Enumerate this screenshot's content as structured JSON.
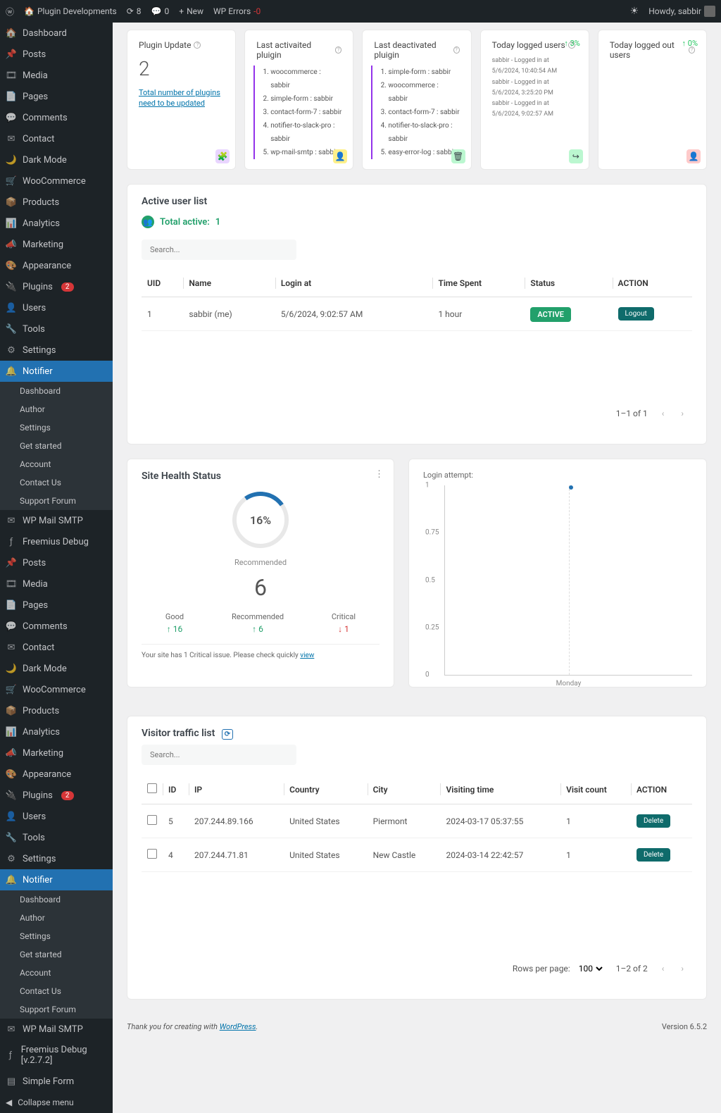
{
  "adminBar": {
    "siteName": "Plugin Developments",
    "updates": "8",
    "comments": "0",
    "newLabel": "New",
    "wpErrors": "WP Errors",
    "wpErrorsCount": "0",
    "howdy": "Howdy, sabbir"
  },
  "sidebar": {
    "items1": [
      {
        "icon": "🏠",
        "label": "Dashboard"
      },
      {
        "icon": "📌",
        "label": "Posts"
      },
      {
        "icon": "🎞",
        "label": "Media"
      },
      {
        "icon": "📄",
        "label": "Pages"
      },
      {
        "icon": "💬",
        "label": "Comments"
      },
      {
        "icon": "✉",
        "label": "Contact"
      },
      {
        "icon": "🌙",
        "label": "Dark Mode"
      },
      {
        "icon": "🛒",
        "label": "WooCommerce"
      },
      {
        "icon": "📦",
        "label": "Products"
      },
      {
        "icon": "📊",
        "label": "Analytics"
      },
      {
        "icon": "📣",
        "label": "Marketing"
      },
      {
        "icon": "🎨",
        "label": "Appearance"
      },
      {
        "icon": "🔌",
        "label": "Plugins",
        "badge": "2"
      },
      {
        "icon": "👤",
        "label": "Users"
      },
      {
        "icon": "🔧",
        "label": "Tools"
      },
      {
        "icon": "⚙",
        "label": "Settings"
      }
    ],
    "notifier": "Notifier",
    "submenu": [
      "Dashboard",
      "Author",
      "Settings",
      "Get started",
      "Account",
      "Contact Us",
      "Support Forum"
    ],
    "wpMailSmtp": "WP Mail SMTP",
    "freemius": "Freemius Debug",
    "items2": [
      {
        "icon": "📌",
        "label": "Posts"
      },
      {
        "icon": "🎞",
        "label": "Media"
      },
      {
        "icon": "📄",
        "label": "Pages"
      },
      {
        "icon": "💬",
        "label": "Comments"
      },
      {
        "icon": "✉",
        "label": "Contact"
      },
      {
        "icon": "🌙",
        "label": "Dark Mode"
      },
      {
        "icon": "🛒",
        "label": "WooCommerce"
      },
      {
        "icon": "📦",
        "label": "Products"
      },
      {
        "icon": "📊",
        "label": "Analytics"
      },
      {
        "icon": "📣",
        "label": "Marketing"
      },
      {
        "icon": "🎨",
        "label": "Appearance"
      },
      {
        "icon": "🔌",
        "label": "Plugins",
        "badge": "2"
      },
      {
        "icon": "👤",
        "label": "Users"
      },
      {
        "icon": "🔧",
        "label": "Tools"
      },
      {
        "icon": "⚙",
        "label": "Settings"
      }
    ],
    "freemius2": "Freemius Debug [v.2.7.2]",
    "simpleForm": "Simple Form",
    "collapse": "Collapse menu"
  },
  "cards": {
    "pluginUpdate": {
      "title": "Plugin Update",
      "count": "2",
      "link": "Total number of plugins need to be updated"
    },
    "lastActivated": {
      "title": "Last activaited pluigin",
      "items": [
        "woocommerce : sabbir",
        "simple-form : sabbir",
        "contact-form-7 : sabbir",
        "notifier-to-slack-pro : sabbir",
        "wp-mail-smtp : sabbir"
      ]
    },
    "lastDeactivated": {
      "title": "Last deactivated pluigin",
      "items": [
        "simple-form : sabbir",
        "woocommerce : sabbir",
        "contact-form-7 : sabbir",
        "notifier-to-slack-pro : sabbir",
        "easy-error-log : sabbir"
      ]
    },
    "loggedIn": {
      "title": "Today logged users",
      "stat": "↑ 3%",
      "items": [
        "sabbir - Logged in at 5/6/2024, 10:40:54 AM",
        "sabbir - Logged in at 5/6/2024, 3:25:20 PM",
        "sabbir - Logged in at 5/6/2024, 9:02:57 AM"
      ]
    },
    "loggedOut": {
      "title": "Today logged out users",
      "stat": "↑ 0%"
    }
  },
  "activeUsers": {
    "title": "Active user list",
    "totalLabel": "Total active:",
    "totalValue": "1",
    "searchPlaceholder": "Search...",
    "headers": [
      "UID",
      "Name",
      "Login at",
      "Time Spent",
      "Status",
      "ACTION"
    ],
    "rows": [
      {
        "uid": "1",
        "name": "sabbir (me)",
        "login": "5/6/2024, 9:02:57 AM",
        "time": "1 hour",
        "status": "ACTIVE",
        "action": "Logout"
      }
    ],
    "pagination": "1–1 of 1"
  },
  "siteHealth": {
    "title": "Site Health Status",
    "percent": "16%",
    "label": "Recommended",
    "big": "6",
    "good": {
      "label": "Good",
      "val": "↑ 16"
    },
    "rec": {
      "label": "Recommended",
      "val": "↑ 6"
    },
    "crit": {
      "label": "Critical",
      "val": "↓ 1"
    },
    "note": "Your site has 1 Critical issue. Please check quickly ",
    "noteLink": "view"
  },
  "chart_data": {
    "type": "scatter",
    "title": "Login attempt:",
    "categories": [
      "Monday"
    ],
    "x": [
      "Monday"
    ],
    "y": [
      1
    ],
    "ylim": [
      0,
      1
    ],
    "yticks": [
      0,
      0.25,
      0.5,
      0.75,
      1
    ],
    "xlabel": "Monday"
  },
  "traffic": {
    "title": "Visitor traffic list",
    "searchPlaceholder": "Search...",
    "headers": [
      "",
      "ID",
      "IP",
      "Country",
      "City",
      "Visiting time",
      "Visit count",
      "ACTION"
    ],
    "rows": [
      {
        "id": "5",
        "ip": "207.244.89.166",
        "country": "United States",
        "city": "Piermont",
        "time": "2024-03-17 05:37:55",
        "count": "1"
      },
      {
        "id": "4",
        "ip": "207.244.71.81",
        "country": "United States",
        "city": "New Castle",
        "time": "2024-03-14 22:42:57",
        "count": "1"
      }
    ],
    "deleteLabel": "Delete",
    "rowsPerPageLabel": "Rows per page:",
    "rowsPerPage": "100",
    "pagination": "1–2 of 2"
  },
  "footer": {
    "thanks": "Thank you for creating with ",
    "wp": "WordPress",
    "version": "Version 6.5.2"
  }
}
